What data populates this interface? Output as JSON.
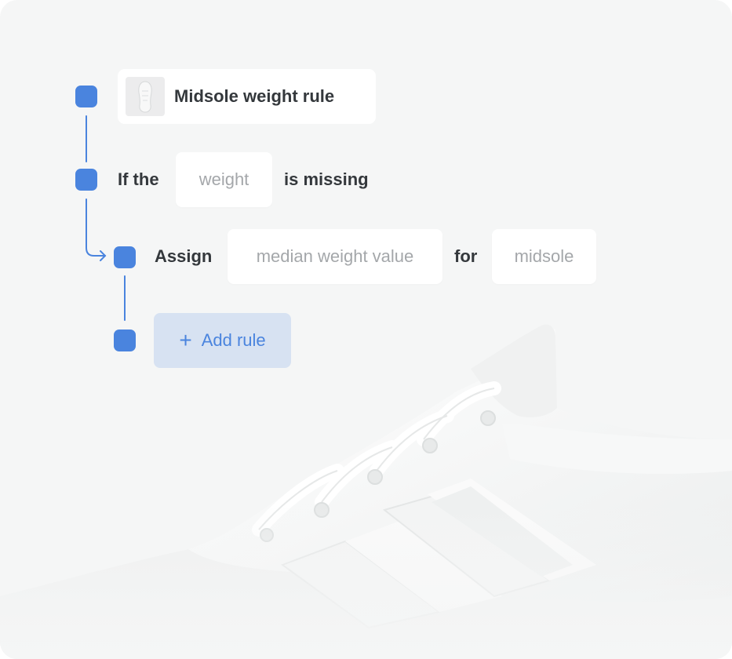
{
  "rule": {
    "title": "Midsole weight rule",
    "thumbnail_icon": "shoe-sole-icon"
  },
  "condition": {
    "prefix": "If the",
    "field": "weight",
    "suffix": "is missing"
  },
  "action": {
    "verb": "Assign",
    "value": "median weight value",
    "connector": "for",
    "target": "midsole"
  },
  "add_rule": {
    "label": "Add rule",
    "icon": "plus-icon"
  },
  "colors": {
    "accent": "#4a84de",
    "add_button_bg": "#d7e2f2",
    "card_bg": "#f5f6f6",
    "text_dark": "#34383c",
    "text_muted": "#a4a7aa"
  }
}
